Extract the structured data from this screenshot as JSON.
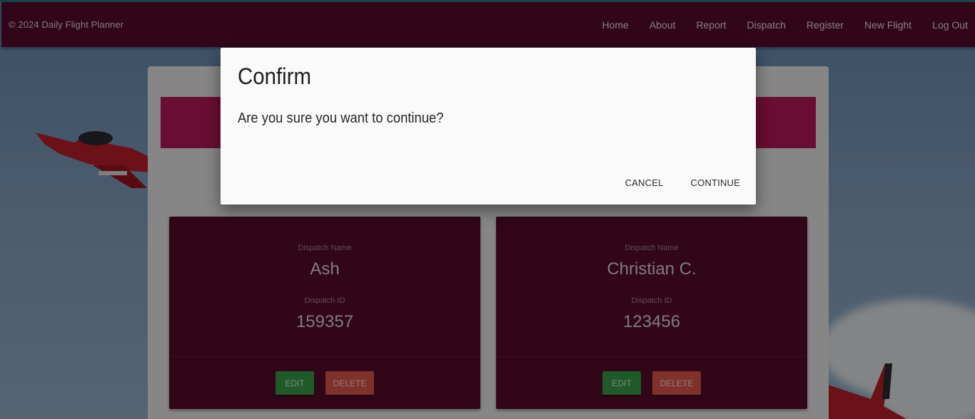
{
  "navbar": {
    "brand": "© 2024 Daily Flight Planner",
    "links": [
      "Home",
      "About",
      "Report",
      "Dispatch",
      "Register",
      "New Flight",
      "Log Out"
    ]
  },
  "cards": [
    {
      "name_label": "Dispatch Name",
      "name": "Ash",
      "id_label": "Dispatch ID",
      "id": "159357",
      "edit_label": "EDIT",
      "delete_label": "DELETE"
    },
    {
      "name_label": "Dispatch Name",
      "name": "Christian C.",
      "id_label": "Dispatch ID",
      "id": "123456",
      "edit_label": "EDIT",
      "delete_label": "DELETE"
    }
  ],
  "modal": {
    "title": "Confirm",
    "message": "Are you sure you want to continue?",
    "cancel_label": "CANCEL",
    "continue_label": "CONTINUE"
  },
  "colors": {
    "navbar": "#5a0c2f",
    "banner": "#c2185b",
    "card": "#5a0c2f",
    "edit": "#3aa54a",
    "delete": "#e9594d"
  }
}
